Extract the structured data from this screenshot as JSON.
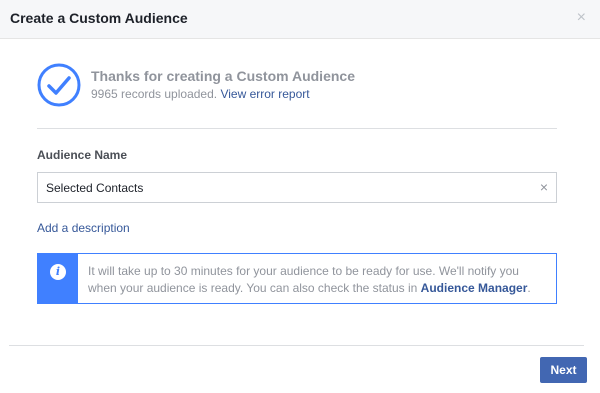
{
  "dialog": {
    "title": "Create a Custom Audience",
    "close_glyph": "×"
  },
  "success": {
    "icon": "check-circle-icon",
    "title": "Thanks for creating a Custom Audience",
    "records_text": "9965 records uploaded.",
    "error_link": "View error report"
  },
  "form": {
    "label": "Audience Name",
    "value": "Selected Contacts",
    "clear_glyph": "×",
    "add_description": "Add a description"
  },
  "notice": {
    "icon": "info-icon",
    "icon_glyph": "i",
    "text": "It will take up to 30 minutes for your audience to be ready for use. We'll notify you when your audience is ready. You can also check the status in",
    "link": "Audience Manager",
    "end": "."
  },
  "footer": {
    "next_label": "Next"
  },
  "colors": {
    "accent": "#4080ff",
    "button": "#4267b2",
    "link": "#365899",
    "muted": "#90949c"
  }
}
